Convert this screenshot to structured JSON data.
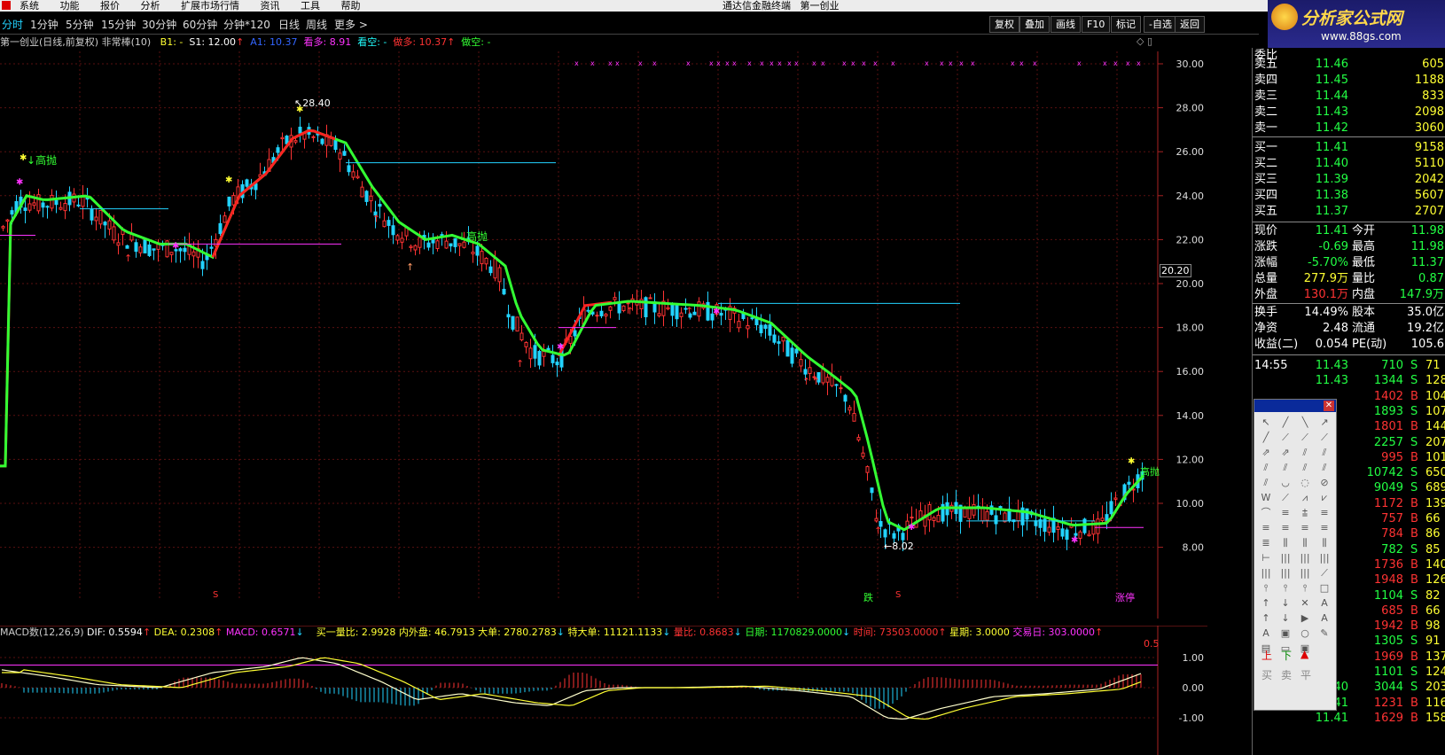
{
  "window_title": "通达信金融终端",
  "window_subtitle": "第一创业",
  "menu": [
    "系统",
    "功能",
    "报价",
    "分析",
    "扩展市场行情",
    "资讯",
    "工具",
    "帮助"
  ],
  "brand": {
    "name": "分析家公式网",
    "url": "www.88gs.com"
  },
  "periods": [
    "分时",
    "1分钟",
    "5分钟",
    "15分钟",
    "30分钟",
    "60分钟",
    "分钟*120",
    "日线",
    "周线",
    "更多 >"
  ],
  "toolbar_right": [
    "复权",
    "叠加",
    "画线",
    "F10",
    "标记",
    "-自选",
    "返回"
  ],
  "chart_info": {
    "stock": "第一创业(日线,前复权) 非常棒(10)",
    "b1": "B1: -",
    "s1": "S1: 12.00",
    "a1": "A1: 10.37",
    "kanduo": "看多: 8.91",
    "kankong": "看空: -",
    "zuoduo": "做多: 10.37",
    "zuokong": "做空: -"
  },
  "price_axis": [
    "30.00",
    "28.00",
    "26.00",
    "24.00",
    "22.00",
    "20.00",
    "18.00",
    "16.00",
    "14.00",
    "12.00",
    "10.00",
    "8.00"
  ],
  "price_marker": "20.20",
  "annotations": {
    "high": "28.40",
    "low": "8.02",
    "gaopao": "高抛",
    "die": "跌",
    "s": "S",
    "zhangting": "涨停"
  },
  "macd_info": {
    "name": "MACD数(12,26,9)",
    "dif": "DIF: 0.5594",
    "dea": "DEA: 0.2308",
    "macd": "MACD: 0.6571",
    "extra": "买一量比: 2.9928 内外盘: 46.7913 大单: 2780.2783",
    "big": "特大单: 11121.1133",
    "ratio": "量比: 0.8683",
    "date": "日期: 1170829.0000",
    "time": "时间: 73503.0000",
    "week": "星期: 3.0000",
    "days": "交易日: 303.0000"
  },
  "macd_axis": [
    "1.00",
    "0.00",
    "-1.00"
  ],
  "macd_marker": "0.5",
  "quote": {
    "weibi": "委比",
    "asks": [
      {
        "label": "卖五",
        "price": "11.46",
        "vol": "605"
      },
      {
        "label": "卖四",
        "price": "11.45",
        "vol": "1188"
      },
      {
        "label": "卖三",
        "price": "11.44",
        "vol": "833"
      },
      {
        "label": "卖二",
        "price": "11.43",
        "vol": "2098"
      },
      {
        "label": "卖一",
        "price": "11.42",
        "vol": "3060"
      }
    ],
    "bids": [
      {
        "label": "买一",
        "price": "11.41",
        "vol": "9158"
      },
      {
        "label": "买二",
        "price": "11.40",
        "vol": "5110"
      },
      {
        "label": "买三",
        "price": "11.39",
        "vol": "2042"
      },
      {
        "label": "买四",
        "price": "11.38",
        "vol": "5607"
      },
      {
        "label": "买五",
        "price": "11.37",
        "vol": "2707"
      }
    ],
    "stats": [
      {
        "l1": "现价",
        "v1": "11.41",
        "l2": "今开",
        "v2": "11.98"
      },
      {
        "l1": "涨跌",
        "v1": "-0.69",
        "l2": "最高",
        "v2": "11.98"
      },
      {
        "l1": "涨幅",
        "v1": "-5.70%",
        "l2": "最低",
        "v2": "11.37"
      },
      {
        "l1": "总量",
        "v1": "277.9万",
        "l2": "量比",
        "v2": "0.87"
      },
      {
        "l1": "外盘",
        "v1": "130.1万",
        "l2": "内盘",
        "v2": "147.9万"
      }
    ],
    "stats2": [
      {
        "l1": "换手",
        "v1": "14.49%",
        "l2": "股本",
        "v2": "35.0亿"
      },
      {
        "l1": "净资",
        "v1": "2.48",
        "l2": "流通",
        "v2": "19.2亿"
      },
      {
        "l1": "收益(二)",
        "v1": "0.054",
        "l2": "PE(动)",
        "v2": "105.6"
      }
    ],
    "ticks": [
      {
        "t": "14:55",
        "p": "11.43",
        "v": "710",
        "d": "S",
        "n": "71"
      },
      {
        "t": "",
        "p": "11.43",
        "v": "1344",
        "d": "S",
        "n": "128"
      },
      {
        "t": "",
        "p": "",
        "v": "1402",
        "d": "B",
        "n": "104"
      },
      {
        "t": "",
        "p": "",
        "v": "1893",
        "d": "S",
        "n": "107"
      },
      {
        "t": "",
        "p": "",
        "v": "1801",
        "d": "B",
        "n": "144"
      },
      {
        "t": "",
        "p": "",
        "v": "2257",
        "d": "S",
        "n": "207"
      },
      {
        "t": "",
        "p": "",
        "v": "995",
        "d": "B",
        "n": "101"
      },
      {
        "t": "",
        "p": "",
        "v": "10742",
        "d": "S",
        "n": "650"
      },
      {
        "t": "",
        "p": "",
        "v": "9049",
        "d": "S",
        "n": "689"
      },
      {
        "t": "",
        "p": "",
        "v": "1172",
        "d": "B",
        "n": "139"
      },
      {
        "t": "",
        "p": "",
        "v": "757",
        "d": "B",
        "n": "66"
      },
      {
        "t": "",
        "p": "",
        "v": "784",
        "d": "B",
        "n": "86"
      },
      {
        "t": "",
        "p": "",
        "v": "782",
        "d": "S",
        "n": "85"
      },
      {
        "t": "",
        "p": "",
        "v": "1736",
        "d": "B",
        "n": "140"
      },
      {
        "t": "",
        "p": "",
        "v": "1948",
        "d": "B",
        "n": "126"
      },
      {
        "t": "",
        "p": "",
        "v": "1104",
        "d": "S",
        "n": "82"
      },
      {
        "t": "",
        "p": "",
        "v": "685",
        "d": "B",
        "n": "66"
      },
      {
        "t": "",
        "p": "",
        "v": "1942",
        "d": "B",
        "n": "98"
      },
      {
        "t": "",
        "p": "",
        "v": "1305",
        "d": "S",
        "n": "91"
      },
      {
        "t": "",
        "p": "",
        "v": "1969",
        "d": "B",
        "n": "137"
      },
      {
        "t": "",
        "p": "",
        "v": "1101",
        "d": "S",
        "n": "124"
      },
      {
        "t": "",
        "p": "11.40",
        "v": "3044",
        "d": "S",
        "n": "203"
      },
      {
        "t": "",
        "p": "11.41",
        "v": "1231",
        "d": "B",
        "n": "116"
      },
      {
        "t": "",
        "p": "11.41",
        "v": "1629",
        "d": "B",
        "n": "158"
      }
    ]
  },
  "tools_labels": {
    "shang": "上",
    "xia": "下",
    "mai": "买",
    "mai2": "卖",
    "ping": "平"
  },
  "colors": {
    "up": "#ff3333",
    "down": "#22d3ff",
    "ma": "#33ff33",
    "text_green": "#22ff44",
    "gold": "#ffff33",
    "magenta": "#ff33ff"
  }
}
